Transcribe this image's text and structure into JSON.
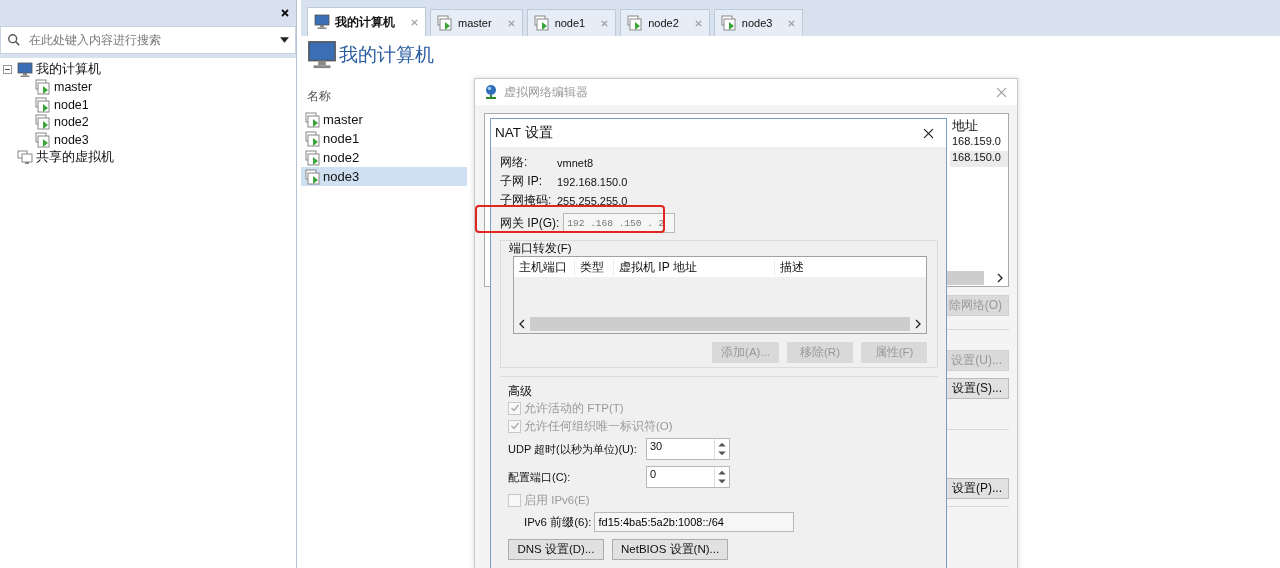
{
  "sidebar": {
    "search": {
      "placeholder": "在此处键入内容进行搜索"
    },
    "tree": [
      {
        "label": "我的计算机",
        "kind": "computer",
        "expanded": true,
        "children": [
          {
            "label": "master",
            "kind": "vm"
          },
          {
            "label": "node1",
            "kind": "vm"
          },
          {
            "label": "node2",
            "kind": "vm"
          },
          {
            "label": "node3",
            "kind": "vm"
          }
        ]
      },
      {
        "label": "共享的虚拟机",
        "kind": "shared"
      }
    ]
  },
  "tabs": [
    {
      "label": "我的计算机",
      "kind": "computer",
      "selected": true
    },
    {
      "label": "master",
      "kind": "vm",
      "selected": false
    },
    {
      "label": "node1",
      "kind": "vm",
      "selected": false
    },
    {
      "label": "node2",
      "kind": "vm",
      "selected": false
    },
    {
      "label": "node3",
      "kind": "vm",
      "selected": false
    }
  ],
  "page": {
    "title": "我的计算机",
    "list_header": "名称",
    "vms": [
      {
        "name": "master",
        "selected": false
      },
      {
        "name": "node1",
        "selected": false
      },
      {
        "name": "node2",
        "selected": false
      },
      {
        "name": "node3",
        "selected": true
      }
    ]
  },
  "network_editor": {
    "title": "虚拟网络编辑器",
    "table": {
      "column_header": "地址",
      "rows": [
        {
          "text": "168.159.0",
          "selected": false
        },
        {
          "text": "168.150.0",
          "selected": true
        }
      ]
    },
    "buttons": [
      {
        "label": "除网络(O)",
        "disabled": true
      },
      {
        "label": "设置(U)...",
        "disabled": true
      },
      {
        "label": "设置(S)...",
        "disabled": false
      },
      {
        "label": "设置(P)...",
        "disabled": false
      }
    ]
  },
  "nat_dialog": {
    "title": "NAT 设置",
    "info": [
      {
        "label": "网络:",
        "value": "vmnet8"
      },
      {
        "label": "子网 IP:",
        "value": "192.168.150.0"
      },
      {
        "label": "子网掩码:",
        "value": "255.255.255.0"
      }
    ],
    "gateway": {
      "label": "网关 IP(G):",
      "value": "192 .168 .150 . 2",
      "highlighted": true
    },
    "port_forwarding": {
      "title": "端口转发(F)",
      "columns": [
        "主机端口",
        "类型",
        "虚拟机 IP 地址",
        "描述"
      ],
      "buttons": [
        {
          "label": "添加(A)...",
          "disabled": true
        },
        {
          "label": "移除(R)",
          "disabled": true
        },
        {
          "label": "属性(F)",
          "disabled": true
        }
      ]
    },
    "advanced": {
      "title": "高级",
      "checkboxes": [
        {
          "label": "允许活动的 FTP(T)",
          "checked": true,
          "disabled": true
        },
        {
          "label": "允许任何组织唯一标识符(O)",
          "checked": true,
          "disabled": true
        }
      ],
      "udp_timeout": {
        "label": "UDP 超时(以秒为单位)(U):",
        "value": "30"
      },
      "config_port": {
        "label": "配置端口(C):",
        "value": "0"
      },
      "ipv6": {
        "label": "启用 IPv6(E)",
        "checked": false,
        "disabled": true
      },
      "ipv6_prefix": {
        "label": "IPv6 前缀(6):",
        "value": "fd15:4ba5:5a2b:1008::/64"
      }
    },
    "bottom_buttons": [
      "DNS 设置(D)...",
      "NetBIOS 设置(N)..."
    ]
  }
}
